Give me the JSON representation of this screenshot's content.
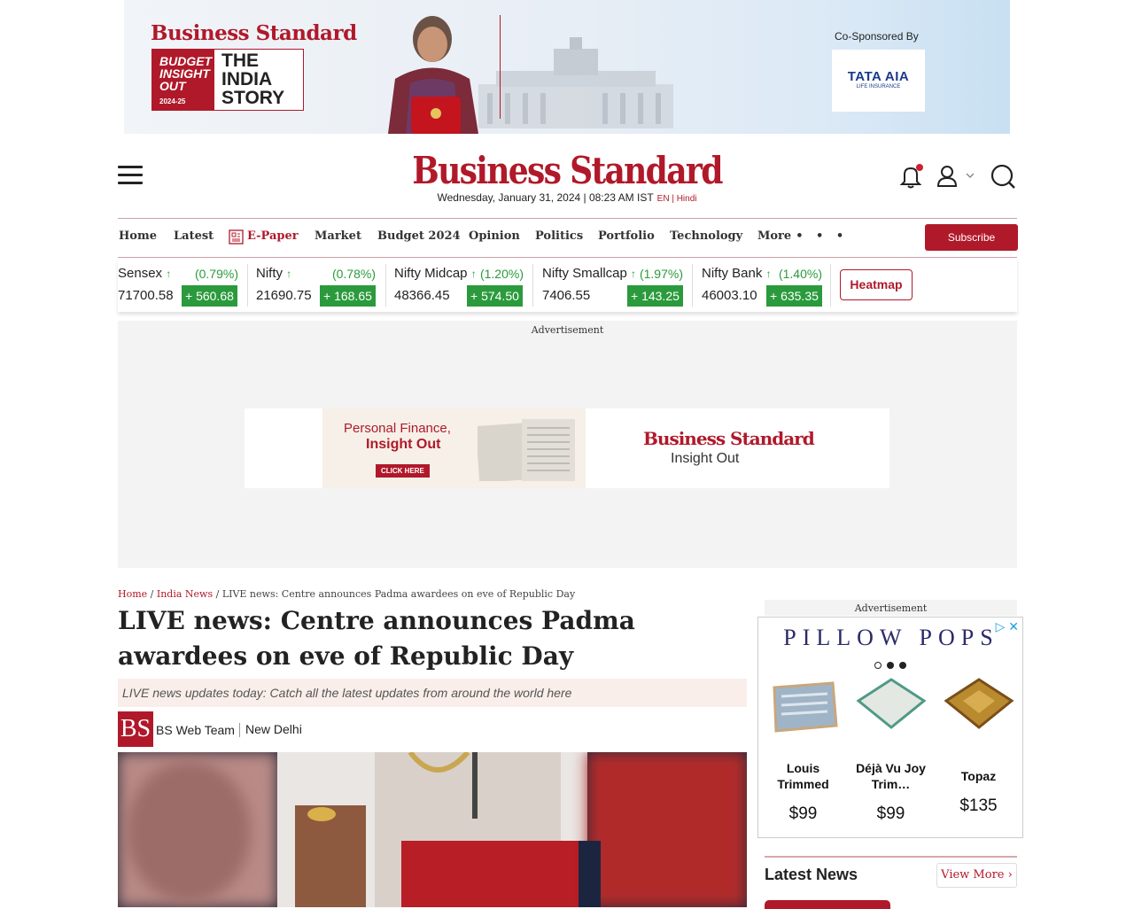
{
  "top_banner": {
    "brand": "Business Standard",
    "badge_line1": "BUDGET",
    "badge_line2": "INSIGHT",
    "badge_line3": "OUT",
    "badge_year": "2024-25",
    "story_line1": "THE",
    "story_line2": "INDIA",
    "story_line3": "STORY",
    "cosponsor_label": "Co-Sponsored By",
    "sponsor_name": "TATA AIA",
    "sponsor_sub": "LIFE INSURANCE"
  },
  "header": {
    "logo": "Business Standard",
    "date": "Wednesday, January 31, 2024 | 08:23 AM IST",
    "lang": "EN | Hindi"
  },
  "nav": {
    "items": [
      "Home",
      "Latest",
      "E-Paper",
      "Market",
      "Budget 2024",
      "Opinion",
      "Politics",
      "Portfolio",
      "Technology",
      "More"
    ],
    "subscribe": "Subscribe"
  },
  "markets": [
    {
      "name": "Sensex",
      "pct": "(0.79%)",
      "value": "71700.58",
      "change": "+ 560.68"
    },
    {
      "name": "Nifty",
      "pct": "(0.78%)",
      "value": "21690.75",
      "change": "+ 168.65"
    },
    {
      "name": "Nifty Midcap",
      "pct": "(1.20%)",
      "value": "48366.45",
      "change": "+ 574.50"
    },
    {
      "name": "Nifty Smallcap",
      "pct": "(1.97%)",
      "value": "7406.55",
      "change": "+ 143.25"
    },
    {
      "name": "Nifty Bank",
      "pct": "(1.40%)",
      "value": "46003.10",
      "change": "+ 635.35"
    }
  ],
  "heatmap": "Heatmap",
  "ad": {
    "label": "Advertisement",
    "line1": "Personal Finance,",
    "line2": "Insight Out",
    "cta": "CLICK HERE",
    "brand": "Business Standard",
    "tagline": "Insight Out"
  },
  "article": {
    "breadcrumb_home": "Home",
    "breadcrumb_section": "India News",
    "breadcrumb_current": "LIVE news: Centre announces Padma awardees on eve of Republic Day",
    "headline": "LIVE news: Centre announces Padma awardees on eve of Republic Day",
    "summary": "LIVE news updates today: Catch all the latest updates from around the world here",
    "author_logo": "BS",
    "author": "BS Web Team",
    "location": "New Delhi"
  },
  "sidebar": {
    "ad_label": "Advertisement",
    "brand": "PILLOW POPS",
    "products": [
      {
        "name": "Louis Trimmed",
        "price": "$99"
      },
      {
        "name": "Déjà Vu Joy Trim…",
        "price": "$99"
      },
      {
        "name": "Topaz",
        "price": "$135"
      }
    ],
    "latest_title": "Latest News",
    "view_more": "View More"
  }
}
